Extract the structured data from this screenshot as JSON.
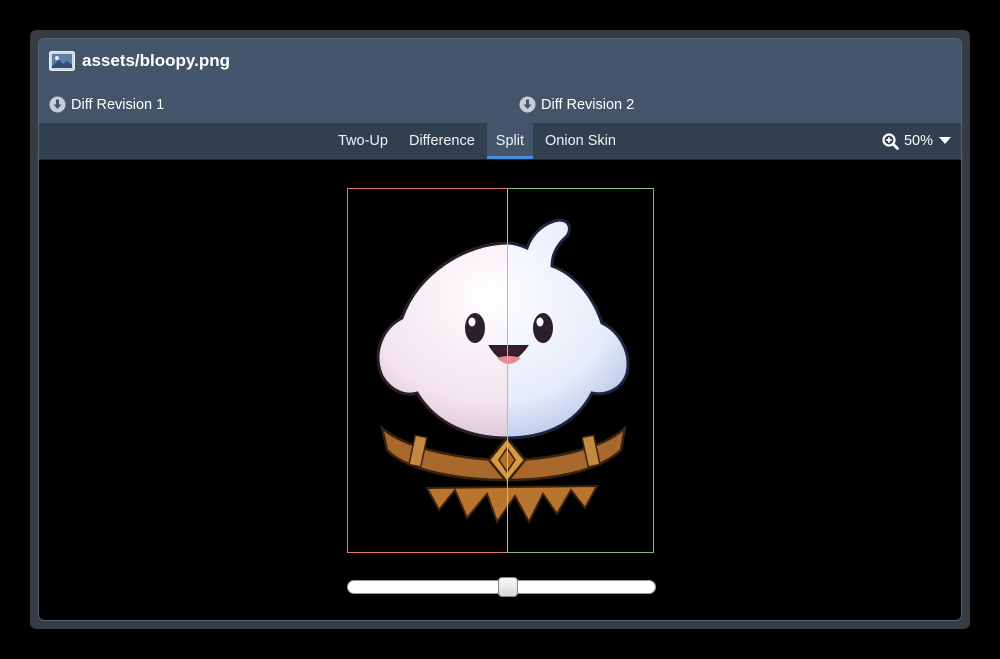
{
  "header": {
    "file_icon": "image-file-icon",
    "file_name": "assets/bloopy.png",
    "revision_1": "Diff Revision 1",
    "revision_2": "Diff Revision 2",
    "revision_icon": "download-circle-icon"
  },
  "toolbar": {
    "tabs": [
      {
        "label": "Two-Up",
        "active": false
      },
      {
        "label": "Difference",
        "active": false
      },
      {
        "label": "Split",
        "active": true
      },
      {
        "label": "Onion Skin",
        "active": false
      }
    ],
    "zoom_icon": "zoom-in-icon",
    "zoom_value": "50%",
    "zoom_dropdown_icon": "caret-down-icon"
  },
  "viewer": {
    "split_position": 0.52,
    "left_border_color": "#e07a72",
    "right_border_color": "#7dc070"
  }
}
